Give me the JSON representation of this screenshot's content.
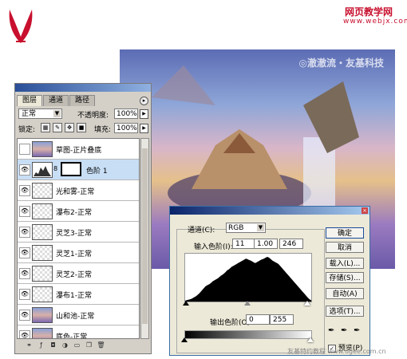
{
  "site": {
    "title": "网页教学网",
    "url": "www.webjx.com"
  },
  "artwork": {
    "watermark": "◎澈澈流・友基科技"
  },
  "layers_panel": {
    "tabs": [
      {
        "label": "图层",
        "active": true
      },
      {
        "label": "通道",
        "active": false
      },
      {
        "label": "路径",
        "active": false
      }
    ],
    "blend_mode": "正常",
    "opacity_label": "不透明度:",
    "opacity_value": "100%",
    "lock_label": "锁定:",
    "fill_label": "填充:",
    "fill_value": "100%",
    "layers": [
      {
        "name": "草图-正片叠底",
        "visible": false
      },
      {
        "name": "色阶 1",
        "visible": true,
        "selected": true,
        "adjustment": true
      },
      {
        "name": "光和雾-正常",
        "visible": true
      },
      {
        "name": "瀑布2-正常",
        "visible": true
      },
      {
        "name": "灵芝3-正常",
        "visible": true
      },
      {
        "name": "灵芝1-正常",
        "visible": true
      },
      {
        "name": "灵芝2-正常",
        "visible": true
      },
      {
        "name": "瀑布1-正常",
        "visible": true
      },
      {
        "name": "山和池-正常",
        "visible": true
      },
      {
        "name": "底色-正常",
        "visible": true
      }
    ]
  },
  "levels_dialog": {
    "channel_label": "通道(C):",
    "channel_value": "RGB",
    "input_label": "输入色阶(I):",
    "input_values": [
      "11",
      "1.00",
      "246"
    ],
    "output_label": "输出色阶(O):",
    "output_values": [
      "0",
      "255"
    ],
    "buttons": [
      "确定",
      "取消",
      "载入(L)...",
      "存储(S)...",
      "自动(A)",
      "选项(T)..."
    ],
    "preview_label": "预览(P)",
    "preview_checked": true,
    "histogram": [
      2,
      3,
      4,
      5,
      6,
      8,
      10,
      12,
      15,
      18,
      22,
      26,
      30,
      34,
      36,
      38,
      40,
      43,
      46,
      48,
      50,
      52,
      55,
      58,
      60,
      63,
      66,
      70,
      72,
      75,
      78,
      80,
      82,
      84,
      86,
      88,
      90,
      92,
      94,
      96,
      95,
      93,
      92,
      90,
      88,
      86,
      88,
      90,
      92,
      94,
      95,
      97,
      99,
      100,
      98,
      95,
      92,
      90,
      88,
      86,
      84,
      80,
      76,
      72,
      68,
      64,
      60,
      56,
      52,
      48,
      44,
      40,
      36,
      32,
      28,
      24,
      20,
      16,
      12,
      8,
      5,
      3
    ]
  },
  "footer": {
    "watermark": "友基特约教程 www.ugee.com.cn"
  }
}
